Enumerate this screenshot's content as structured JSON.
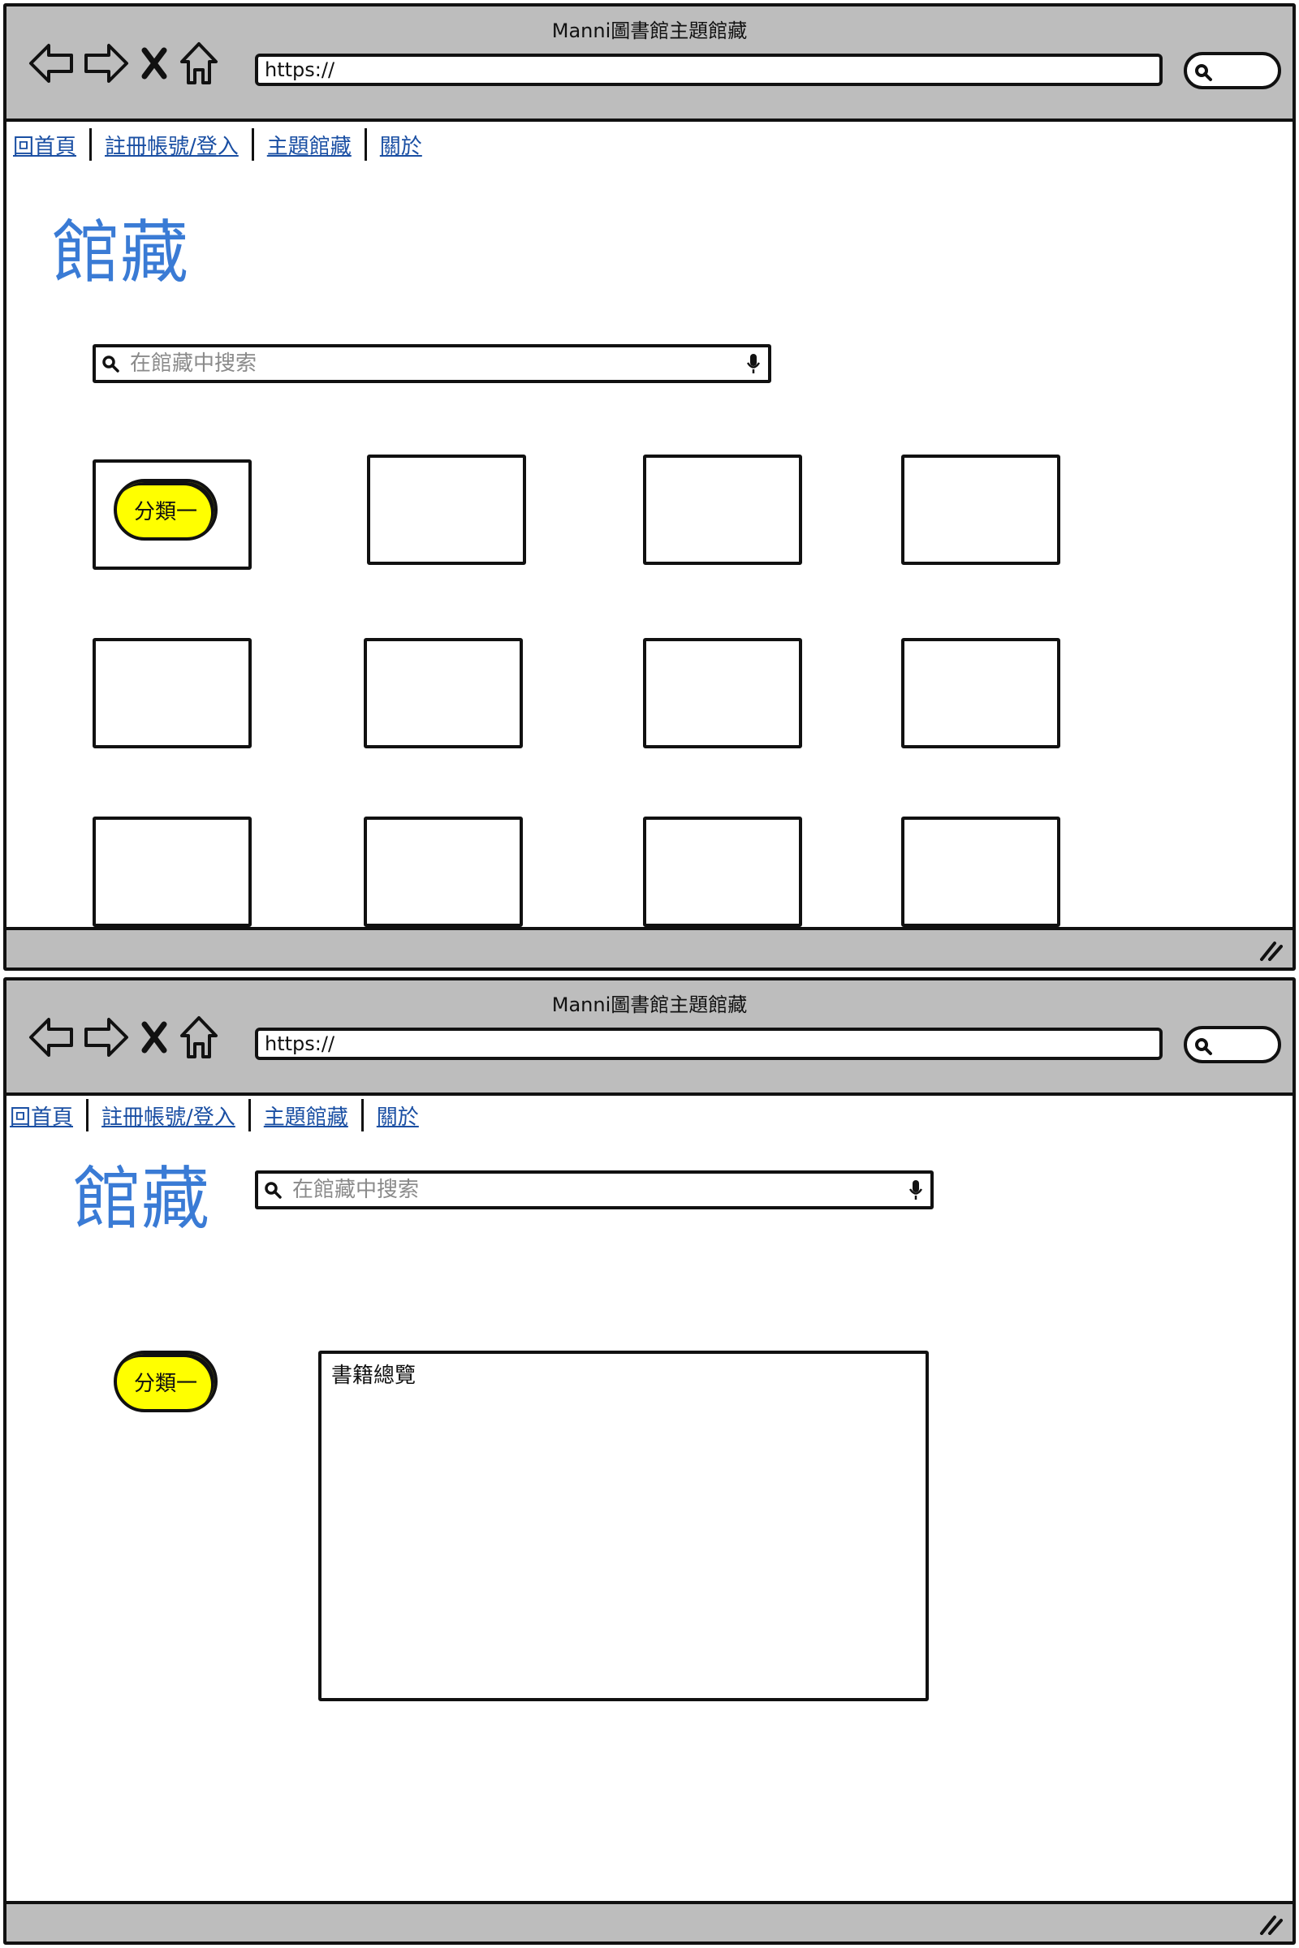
{
  "window_title": "Manni圖書館主題館藏",
  "url": "https://",
  "nav": {
    "home": "回首頁",
    "register_login": "註冊帳號/登入",
    "collections": "主題館藏",
    "about": "關於"
  },
  "page_title": "館藏",
  "search_placeholder": "在館藏中搜索",
  "category_label": "分類一",
  "overview_label": "書籍總覽",
  "icons": {
    "back": "arrow-left-icon",
    "forward": "arrow-right-icon",
    "stop": "close-icon",
    "home": "home-icon",
    "search": "search-icon",
    "mic": "microphone-icon",
    "grip": "resize-grip-icon"
  },
  "colors": {
    "accent": "#3a7bd5",
    "link": "#1a4fa3",
    "category": "#ffff00",
    "chrome": "#bdbdbd"
  }
}
